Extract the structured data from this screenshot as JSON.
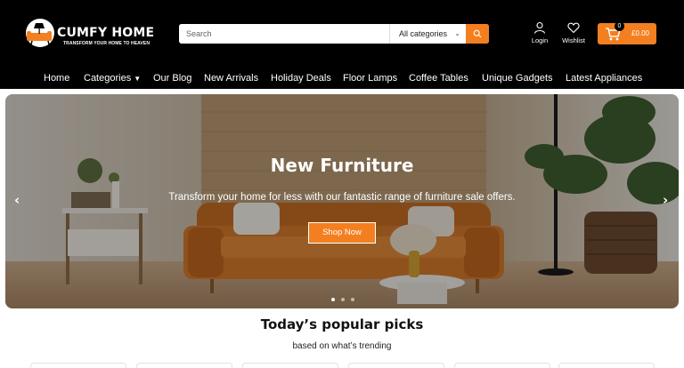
{
  "brand": {
    "name": "CUMFY HOME",
    "tagline": "TRANSFORM YOUR HOME TO HEAVEN",
    "logo_icon": "sofa-lamp-logo"
  },
  "search": {
    "placeholder": "Search",
    "category_selected": "All categories",
    "button_icon": "search-icon"
  },
  "header_actions": {
    "login_label": "Login",
    "login_icon": "user-icon",
    "wishlist_label": "Wishlist",
    "wishlist_icon": "heart-icon",
    "cart_count": "0",
    "cart_total": "£0.00",
    "cart_icon": "cart-icon"
  },
  "nav": {
    "items": [
      {
        "label": "Home"
      },
      {
        "label": "Categories",
        "has_dropdown": true
      },
      {
        "label": "Our Blog"
      },
      {
        "label": "New Arrivals"
      },
      {
        "label": "Holiday Deals"
      },
      {
        "label": "Floor Lamps"
      },
      {
        "label": "Coffee Tables"
      },
      {
        "label": "Unique Gadgets"
      },
      {
        "label": "Latest Appliances"
      }
    ]
  },
  "hero": {
    "title": "New Furniture",
    "subtitle": "Transform your home for less with our fantastic range of furniture sale offers.",
    "cta_label": "Shop Now",
    "prev_arrow": "‹",
    "next_arrow": "›",
    "slides_count": 3,
    "active_slide": 1
  },
  "popular": {
    "title": "Today’s popular picks",
    "subtitle": "based on what’s trending"
  },
  "colors": {
    "accent": "#f47f20",
    "header_bg": "#000000",
    "text_dark": "#111111"
  }
}
